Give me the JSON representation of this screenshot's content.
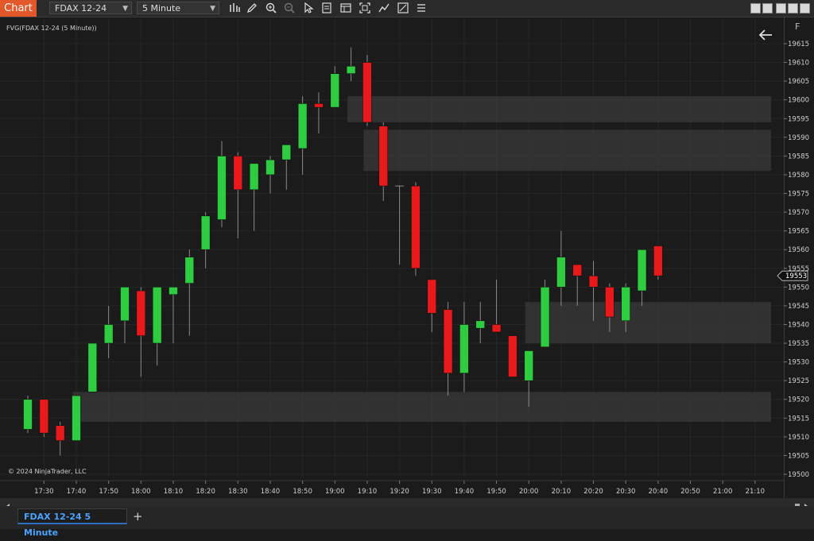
{
  "toolbar": {
    "app_label": "Chart",
    "instrument": "FDAX 12-24",
    "interval": "5 Minute",
    "icons": [
      "bar-type-icon",
      "pencil-icon",
      "zoom-in-icon",
      "zoom-out-icon",
      "pointer-icon",
      "properties-icon",
      "template-icon",
      "screenshot-icon",
      "strategy-icon",
      "data-box-icon",
      "misc-icon"
    ]
  },
  "window_controls": [
    "window-left-icon",
    "window-right-icon",
    "minimize-icon",
    "maximize-icon",
    "close-icon"
  ],
  "chart": {
    "title": "FVG(FDAX 12-24 (5 Minute))",
    "copyright": "© 2024 NinjaTrader, LLC",
    "f_button": "F",
    "price_ticks": [
      "19615",
      "19610",
      "19605",
      "19600",
      "19595",
      "19590",
      "19585",
      "19580",
      "19575",
      "19570",
      "19565",
      "19560",
      "19555",
      "19550",
      "19545",
      "19540",
      "19535",
      "19530",
      "19525",
      "19520",
      "19515",
      "19510",
      "19505",
      "19500"
    ],
    "time_ticks": [
      "17:30",
      "17:40",
      "17:50",
      "18:00",
      "18:10",
      "18:20",
      "18:30",
      "18:40",
      "18:50",
      "19:00",
      "19:10",
      "19:20",
      "19:30",
      "19:40",
      "19:50",
      "20:00",
      "20:10",
      "20:20",
      "20:30",
      "20:40",
      "20:50",
      "21:00",
      "21:10"
    ],
    "last_price": "19553"
  },
  "chart_data": {
    "type": "candlestick",
    "instrument": "FDAX 12-24",
    "interval": "5 Minute",
    "ylim": [
      19499,
      19617
    ],
    "up_color": "#2ecc40",
    "down_color": "#e8191b",
    "zone_color": "#3a3a3a",
    "candles": [
      {
        "o": 19512,
        "h": 19521,
        "l": 19511,
        "c": 19520
      },
      {
        "o": 19520,
        "h": 19520,
        "l": 19510,
        "c": 19511
      },
      {
        "o": 19513,
        "h": 19514,
        "l": 19505,
        "c": 19509
      },
      {
        "o": 19509,
        "h": 19521,
        "l": 19509,
        "c": 19521
      },
      {
        "o": 19522,
        "h": 19535,
        "l": 19522,
        "c": 19535
      },
      {
        "o": 19535,
        "h": 19545,
        "l": 19531,
        "c": 19540
      },
      {
        "o": 19541,
        "h": 19550,
        "l": 19535,
        "c": 19550
      },
      {
        "o": 19549,
        "h": 19550,
        "l": 19526,
        "c": 19537
      },
      {
        "o": 19535,
        "h": 19550,
        "l": 19529,
        "c": 19550
      },
      {
        "o": 19548,
        "h": 19550,
        "l": 19535,
        "c": 19550
      },
      {
        "o": 19551,
        "h": 19560,
        "l": 19537,
        "c": 19558
      },
      {
        "o": 19560,
        "h": 19570,
        "l": 19555,
        "c": 19569
      },
      {
        "o": 19568,
        "h": 19589,
        "l": 19566,
        "c": 19585
      },
      {
        "o": 19585,
        "h": 19586,
        "l": 19563,
        "c": 19576
      },
      {
        "o": 19576,
        "h": 19583,
        "l": 19565,
        "c": 19583
      },
      {
        "o": 19580,
        "h": 19585,
        "l": 19575,
        "c": 19584
      },
      {
        "o": 19584,
        "h": 19588,
        "l": 19576,
        "c": 19588
      },
      {
        "o": 19587,
        "h": 19601,
        "l": 19580,
        "c": 19599
      },
      {
        "o": 19599,
        "h": 19602,
        "l": 19591,
        "c": 19598
      },
      {
        "o": 19598,
        "h": 19609,
        "l": 19598,
        "c": 19607
      },
      {
        "o": 19607,
        "h": 19614,
        "l": 19605,
        "c": 19609
      },
      {
        "o": 19610,
        "h": 19612,
        "l": 19593,
        "c": 19594
      },
      {
        "o": 19593,
        "h": 19594,
        "l": 19573,
        "c": 19577
      },
      {
        "o": 19577,
        "h": 19577,
        "l": 19556,
        "c": 19577
      },
      {
        "o": 19577,
        "h": 19578,
        "l": 19553,
        "c": 19555
      },
      {
        "o": 19552,
        "h": 19552,
        "l": 19538,
        "c": 19543
      },
      {
        "o": 19544,
        "h": 19546,
        "l": 19521,
        "c": 19527
      },
      {
        "o": 19527,
        "h": 19546,
        "l": 19522,
        "c": 19540
      },
      {
        "o": 19539,
        "h": 19546,
        "l": 19535,
        "c": 19541
      },
      {
        "o": 19540,
        "h": 19552,
        "l": 19538,
        "c": 19538
      },
      {
        "o": 19537,
        "h": 19537,
        "l": 19526,
        "c": 19526
      },
      {
        "o": 19525,
        "h": 19533,
        "l": 19518,
        "c": 19533
      },
      {
        "o": 19534,
        "h": 19552,
        "l": 19534,
        "c": 19550
      },
      {
        "o": 19550,
        "h": 19565,
        "l": 19545,
        "c": 19558
      },
      {
        "o": 19556,
        "h": 19556,
        "l": 19545,
        "c": 19553
      },
      {
        "o": 19553,
        "h": 19557,
        "l": 19541,
        "c": 19550
      },
      {
        "o": 19550,
        "h": 19551,
        "l": 19538,
        "c": 19542
      },
      {
        "o": 19541,
        "h": 19551,
        "l": 19538,
        "c": 19550
      },
      {
        "o": 19549,
        "h": 19560,
        "l": 19545,
        "c": 19560
      },
      {
        "o": 19561,
        "h": 19561,
        "l": 19552,
        "c": 19553
      }
    ],
    "zones": [
      {
        "start_index": 20,
        "top": 19601,
        "bottom": 19594
      },
      {
        "start_index": 21,
        "top": 19592,
        "bottom": 19581
      },
      {
        "start_index": 31,
        "top": 19546,
        "bottom": 19535
      },
      {
        "start_index": 3,
        "top": 19522,
        "bottom": 19514
      }
    ]
  },
  "tabs": {
    "active": "FDAX 12-24 5 Minute",
    "add": "+"
  }
}
